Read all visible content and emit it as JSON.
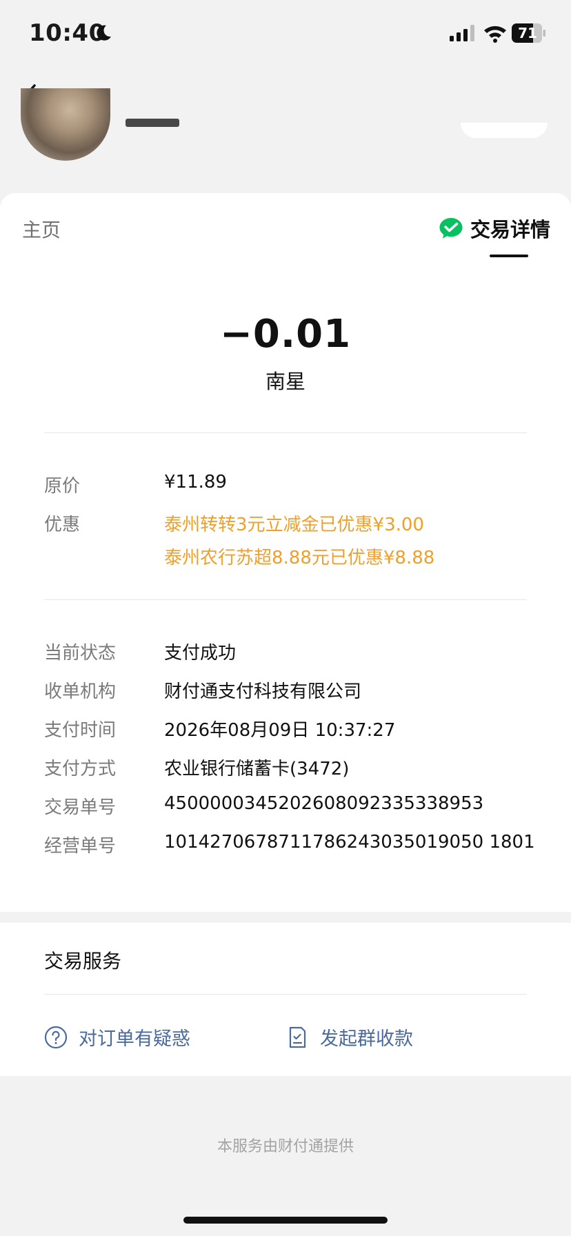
{
  "status_bar": {
    "time": "10:40",
    "battery": "71"
  },
  "tabs": {
    "home": "主页",
    "detail": "交易详情"
  },
  "transaction": {
    "amount": "−0.01",
    "merchant": "南星"
  },
  "price": {
    "label": "原价",
    "value": "¥11.89"
  },
  "discount": {
    "label": "优惠",
    "lines": [
      "泰州转转3元立减金已优惠¥3.00",
      "泰州农行苏超8.88元已优惠¥8.88"
    ]
  },
  "details": [
    {
      "label": "当前状态",
      "value": "支付成功"
    },
    {
      "label": "收单机构",
      "value": "财付通支付科技有限公司"
    },
    {
      "label": "支付时间",
      "value": "2026年08月09日 10:37:27"
    },
    {
      "label": "支付方式",
      "value": "农业银行储蓄卡(3472)"
    },
    {
      "label": "交易单号",
      "value": "4500000345202608092335338953"
    },
    {
      "label": "经营单号",
      "value": "1014270678711786243035019050 1801"
    }
  ],
  "services": {
    "title": "交易服务",
    "actions": [
      {
        "label": "对订单有疑惑",
        "icon": "question-circle-icon"
      },
      {
        "label": "发起群收款",
        "icon": "bill-icon"
      }
    ]
  },
  "footer": "本服务由财付通提供",
  "colors": {
    "accent_orange": "#f0a02a",
    "link_blue": "#4b6a9b",
    "wechat_green": "#07c160"
  }
}
